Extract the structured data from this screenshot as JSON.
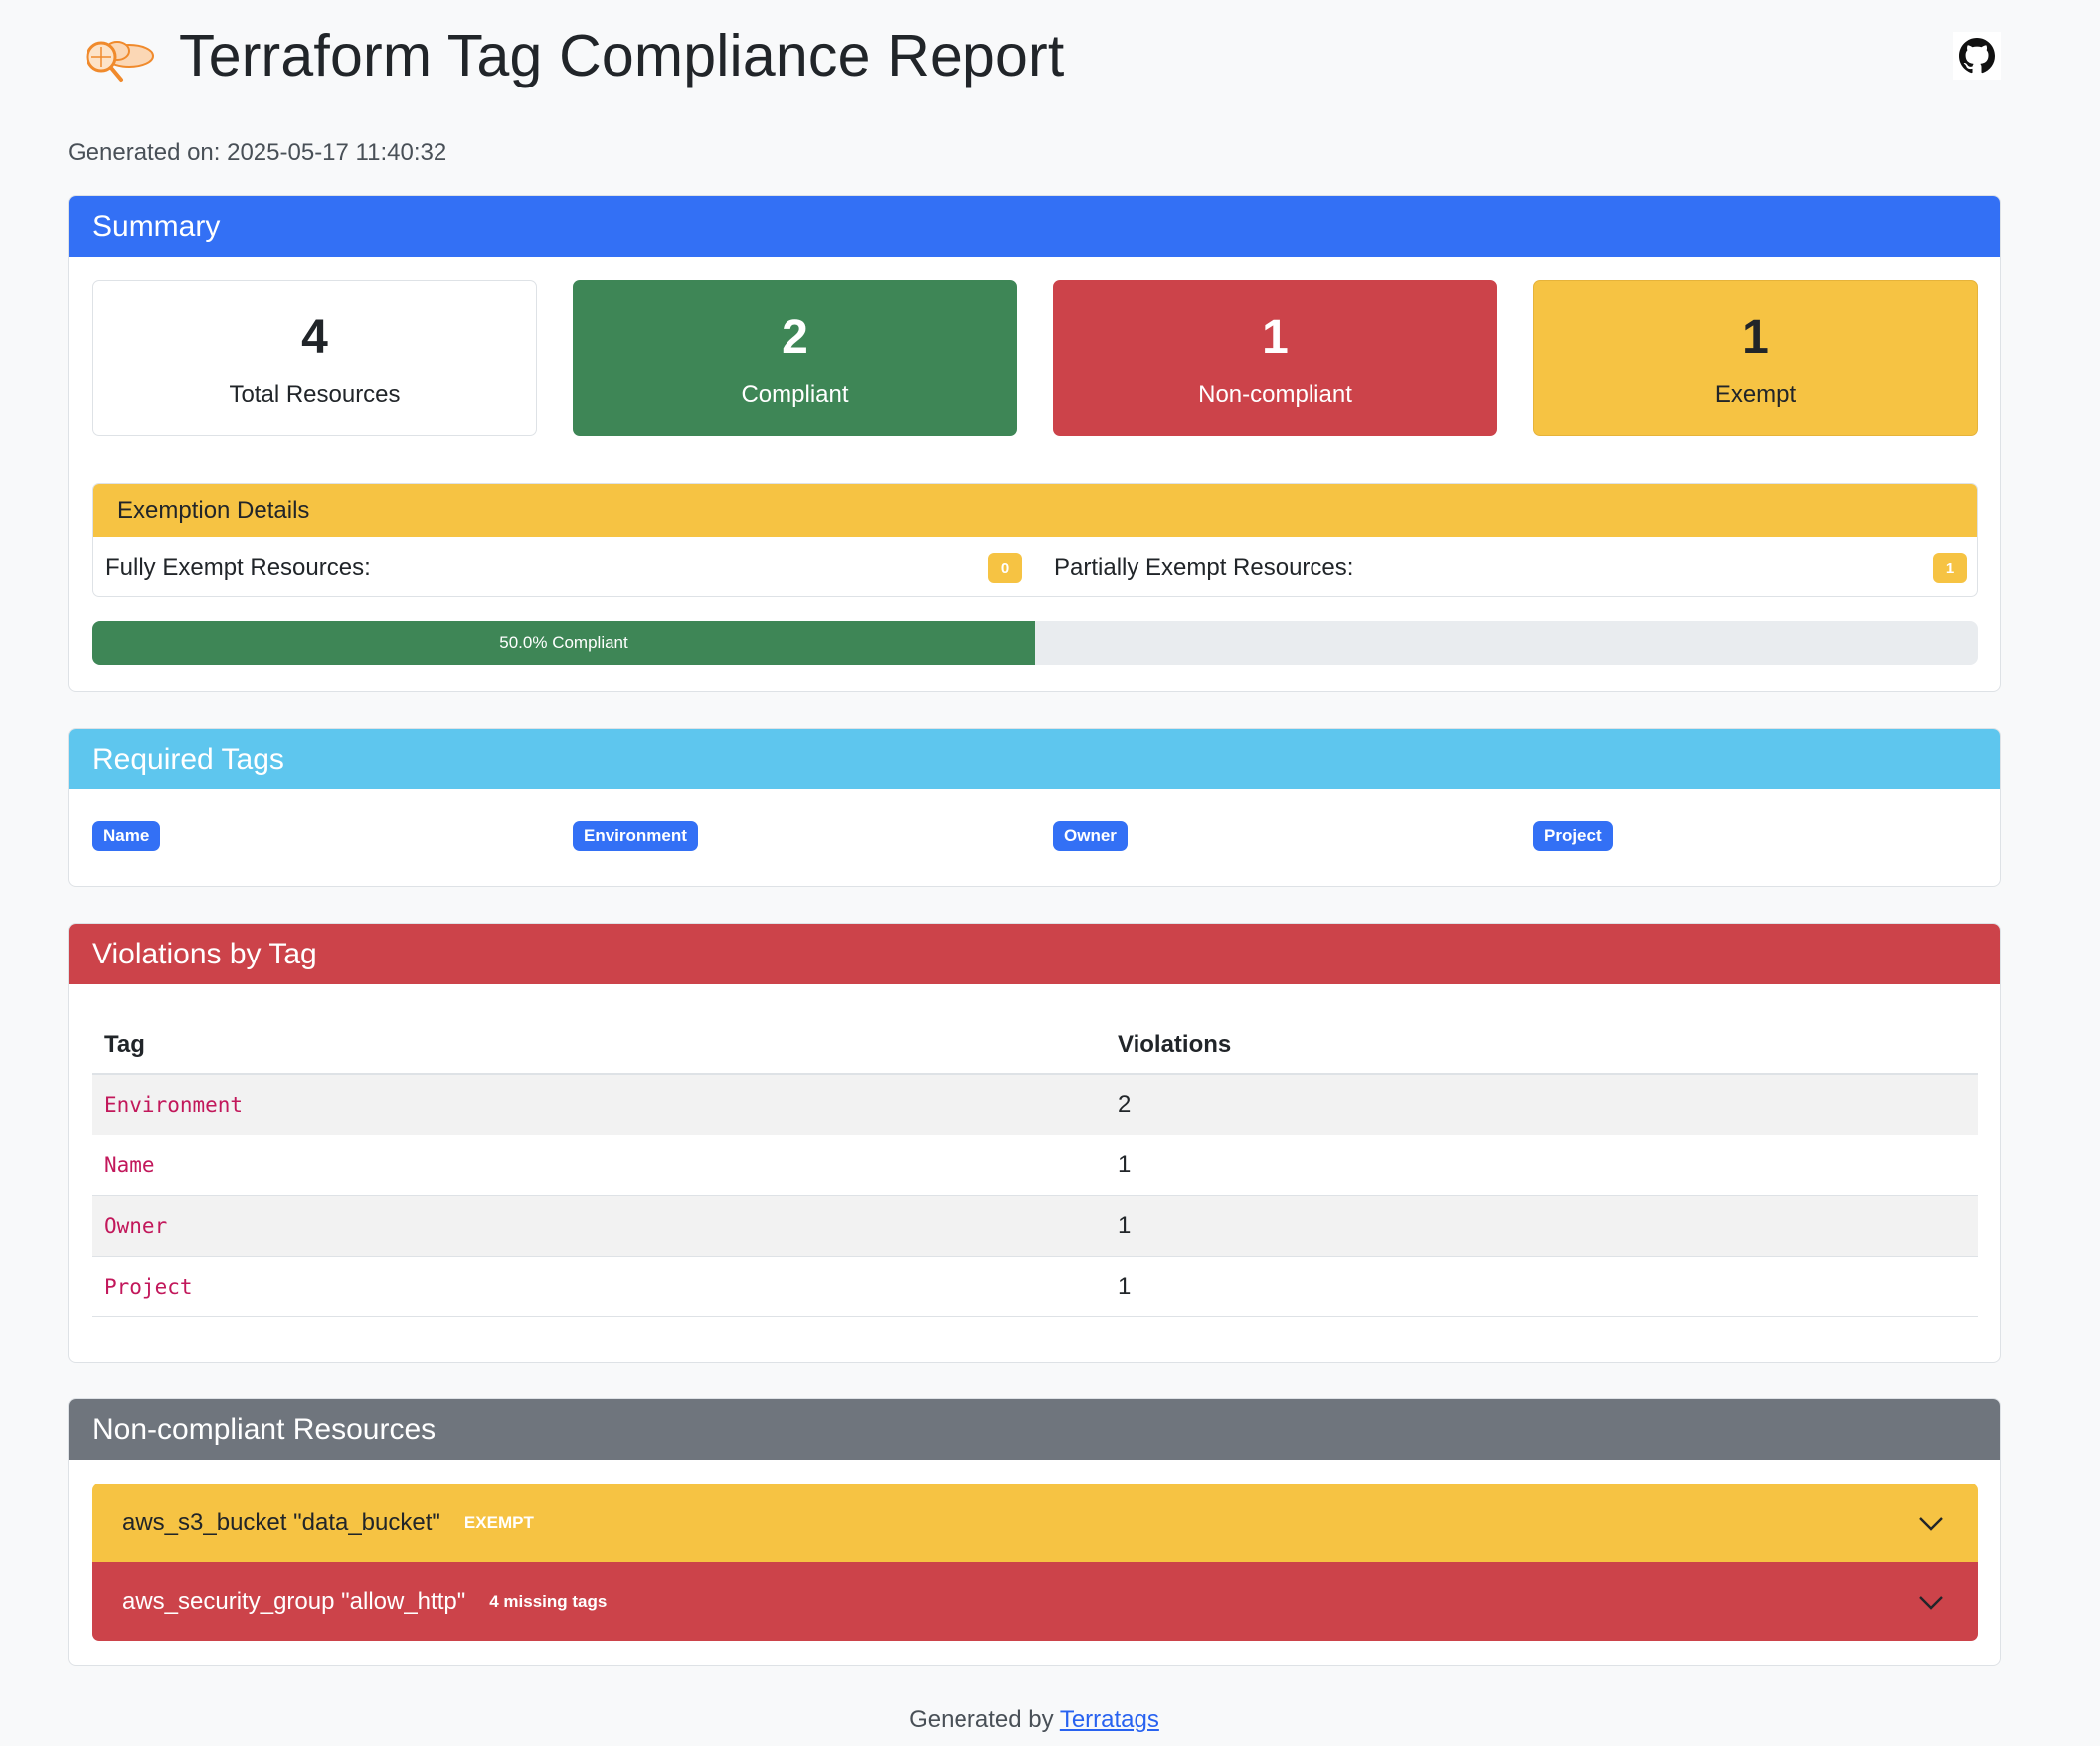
{
  "header": {
    "title": "Terraform Tag Compliance Report",
    "generated_label": "Generated on: 2025-05-17 11:40:32"
  },
  "colors": {
    "primary": "#3370f5",
    "info": "#5ec6ee",
    "success": "#3e8656",
    "danger": "#cc434a",
    "warning": "#f6c343",
    "secondary": "#6f757d"
  },
  "summary": {
    "heading": "Summary",
    "stats": [
      {
        "value": "4",
        "label": "Total Resources"
      },
      {
        "value": "2",
        "label": "Compliant"
      },
      {
        "value": "1",
        "label": "Non-compliant"
      },
      {
        "value": "1",
        "label": "Exempt"
      }
    ],
    "exemption": {
      "heading": "Exemption Details",
      "fully_label": "Fully Exempt Resources:",
      "fully_count": "0",
      "partially_label": "Partially Exempt Resources:",
      "partially_count": "1"
    },
    "progress": {
      "percent": 50,
      "label": "50.0% Compliant"
    }
  },
  "required_tags": {
    "heading": "Required Tags",
    "tags": [
      "Name",
      "Environment",
      "Owner",
      "Project"
    ]
  },
  "violations": {
    "heading": "Violations by Tag",
    "columns": [
      "Tag",
      "Violations"
    ],
    "rows": [
      {
        "tag": "Environment",
        "count": "2"
      },
      {
        "tag": "Name",
        "count": "1"
      },
      {
        "tag": "Owner",
        "count": "1"
      },
      {
        "tag": "Project",
        "count": "1"
      }
    ]
  },
  "noncompliant": {
    "heading": "Non-compliant Resources",
    "items": [
      {
        "name": "aws_s3_bucket \"data_bucket\"",
        "badge": "EXEMPT"
      },
      {
        "name": "aws_security_group \"allow_http\"",
        "badge": "4 missing tags"
      }
    ]
  },
  "footer": {
    "prefix": "Generated by ",
    "link": "Terratags"
  }
}
